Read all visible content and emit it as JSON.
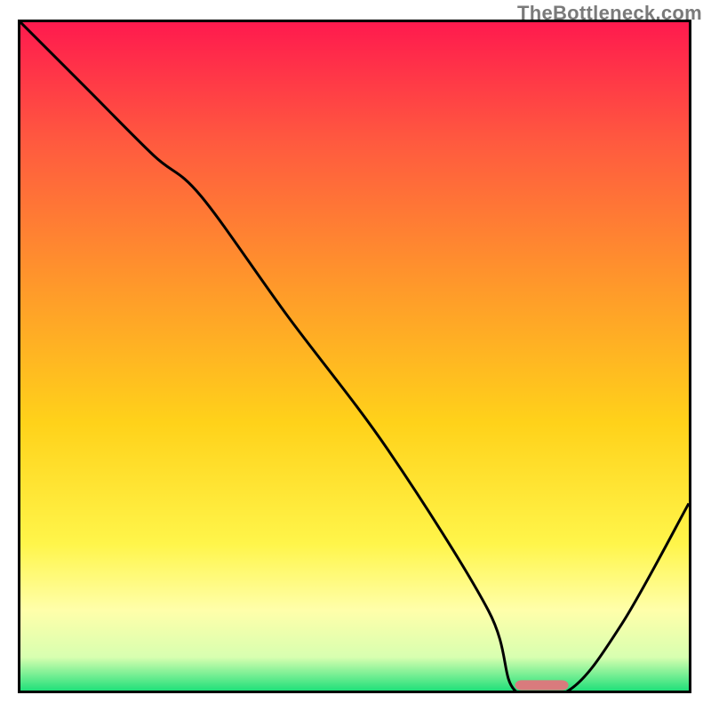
{
  "watermark": "TheBottleneck.com",
  "chart_data": {
    "type": "line",
    "title": "",
    "xlabel": "",
    "ylabel": "",
    "xlim": [
      0,
      100
    ],
    "ylim": [
      0,
      100
    ],
    "grid": false,
    "legend": false,
    "series": [
      {
        "name": "curve",
        "x": [
          0,
          10,
          20,
          27,
          40,
          55,
          70,
          74,
          82,
          90,
          100
        ],
        "y": [
          100,
          90,
          80,
          74,
          56,
          36,
          12,
          0,
          0,
          10,
          28
        ]
      }
    ],
    "marker": {
      "x_start": 74,
      "x_end": 82,
      "y": 0.8,
      "color": "#d97b7d"
    },
    "background_gradient": {
      "stops": [
        {
          "offset": 0.0,
          "color": "#ff1a4e"
        },
        {
          "offset": 0.18,
          "color": "#ff5a3f"
        },
        {
          "offset": 0.4,
          "color": "#ff9a2a"
        },
        {
          "offset": 0.6,
          "color": "#ffd21a"
        },
        {
          "offset": 0.78,
          "color": "#fff54a"
        },
        {
          "offset": 0.88,
          "color": "#ffffaa"
        },
        {
          "offset": 0.95,
          "color": "#d8ffb0"
        },
        {
          "offset": 1.0,
          "color": "#21e07a"
        }
      ]
    },
    "curve_stroke": "#000000",
    "curve_width": 3
  }
}
